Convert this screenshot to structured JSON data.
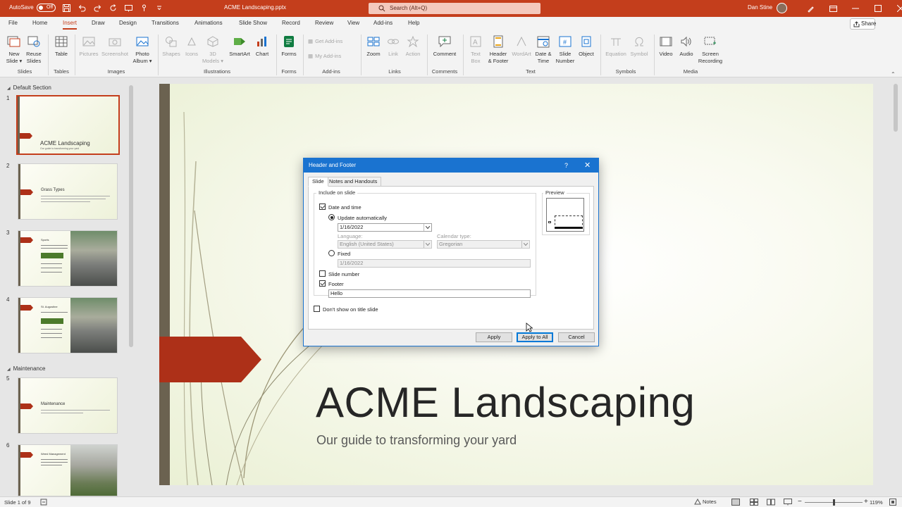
{
  "titlebar": {
    "autosave_label": "AutoSave",
    "autosave_state": "Off",
    "doc_title": "ACME Landscaping.pptx",
    "search_placeholder": "Search (Alt+Q)",
    "user_name": "Dan Stine"
  },
  "tabs": [
    "File",
    "Home",
    "Insert",
    "Draw",
    "Design",
    "Transitions",
    "Animations",
    "Slide Show",
    "Record",
    "Review",
    "View",
    "Add-ins",
    "Help"
  ],
  "active_tab": "Insert",
  "share_label": "Share",
  "ribbon": {
    "new_slide": [
      "New",
      "Slide ▾"
    ],
    "reuse_slides": [
      "Reuse",
      "Slides"
    ],
    "table": "Table",
    "pictures": "Pictures",
    "screenshot": "Screenshot",
    "photo_album": [
      "Photo",
      "Album ▾"
    ],
    "shapes": "Shapes",
    "icons": "Icons",
    "models_3d": [
      "3D",
      "Models ▾"
    ],
    "smartart": "SmartArt",
    "chart": "Chart",
    "forms": "Forms",
    "get_addins": "Get Add-ins",
    "my_addins": "My Add-ins",
    "zoom": "Zoom",
    "link": "Link",
    "action": "Action",
    "comment": "Comment",
    "text_box": [
      "Text",
      "Box"
    ],
    "header_footer": [
      "Header",
      "& Footer"
    ],
    "wordart": "WordArt",
    "date_time": [
      "Date &",
      "Time"
    ],
    "slide_number": [
      "Slide",
      "Number"
    ],
    "object": "Object",
    "equation": "Equation",
    "symbol": "Symbol",
    "video": "Video",
    "audio": "Audio",
    "screen_recording": [
      "Screen",
      "Recording"
    ],
    "groups": {
      "slides": "Slides",
      "tables": "Tables",
      "images": "Images",
      "illustrations": "Illustrations",
      "forms": "Forms",
      "addins": "Add-ins",
      "links": "Links",
      "comments": "Comments",
      "text": "Text",
      "symbols": "Symbols",
      "media": "Media"
    }
  },
  "pane": {
    "sections": [
      "Default Section",
      "Maintenance"
    ],
    "slides": [
      {
        "num": "1",
        "title": "ACME Landscaping",
        "sub": "Our guide to transforming your yard"
      },
      {
        "num": "2",
        "title": "Grass Types"
      },
      {
        "num": "3",
        "title": "Sports"
      },
      {
        "num": "4",
        "title": "St. Augustine"
      },
      {
        "num": "5",
        "title": "Maintenance"
      },
      {
        "num": "6",
        "title": "Weed Management"
      }
    ]
  },
  "slide": {
    "title": "ACME Landscaping",
    "subtitle": "Our guide to transforming your yard",
    "accent_color": "#ad3018",
    "bar_color": "#6b6250"
  },
  "dialog": {
    "title": "Header and Footer",
    "help": "?",
    "tabs": [
      "Slide",
      "Notes and Handouts"
    ],
    "include_label": "Include on slide",
    "date_time_label": "Date and time",
    "date_time_checked": true,
    "update_auto_label": "Update automatically",
    "date_value": "1/16/2022",
    "language_label": "Language:",
    "language_value": "English (United States)",
    "calendar_label": "Calendar type:",
    "calendar_value": "Gregorian",
    "fixed_label": "Fixed",
    "fixed_value": "1/16/2022",
    "slide_number_label": "Slide number",
    "slide_number_checked": false,
    "footer_label": "Footer",
    "footer_checked": true,
    "footer_value": "Hello",
    "dont_show_label": "Don't show on title slide",
    "preview_label": "Preview",
    "apply": "Apply",
    "apply_all": "Apply to All",
    "cancel": "Cancel"
  },
  "status": {
    "slide_of": "Slide 1 of 9",
    "notes": "Notes",
    "zoom": "119%"
  }
}
